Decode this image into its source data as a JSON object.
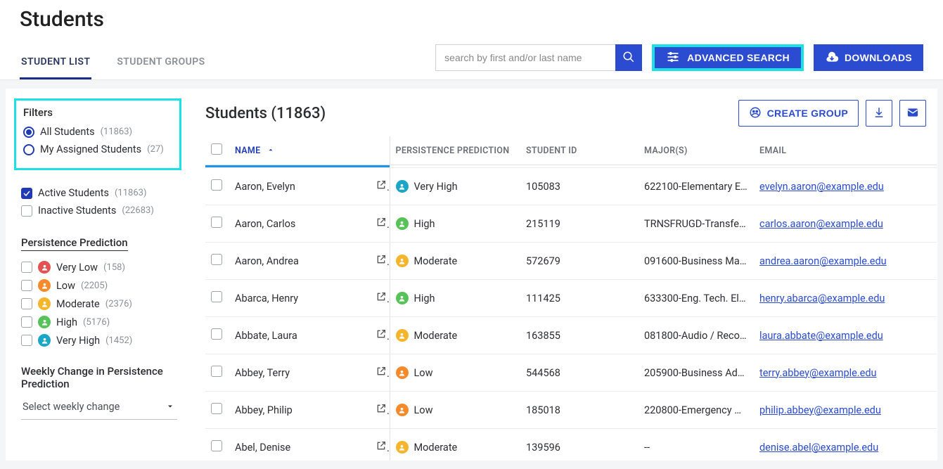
{
  "header": {
    "title": "Students",
    "tabs": [
      {
        "label": "STUDENT LIST",
        "active": true
      },
      {
        "label": "STUDENT GROUPS",
        "active": false
      }
    ],
    "search_placeholder": "search by first and/or last name",
    "advanced_search_label": "ADVANCED SEARCH",
    "downloads_label": "DOWNLOADS"
  },
  "sidebar": {
    "filters_title": "Filters",
    "scope": [
      {
        "label": "All Students",
        "count": "(11863)",
        "selected": true
      },
      {
        "label": "My Assigned Students",
        "count": "(27)",
        "selected": false
      }
    ],
    "status": [
      {
        "label": "Active Students",
        "count": "(11863)",
        "checked": true
      },
      {
        "label": "Inactive Students",
        "count": "(22683)",
        "checked": false
      }
    ],
    "persistence_title": "Persistence Prediction",
    "levels": [
      {
        "label": "Very Low",
        "count": "(158)",
        "class": "dot-vlow"
      },
      {
        "label": "Low",
        "count": "(2205)",
        "class": "dot-low"
      },
      {
        "label": "Moderate",
        "count": "(2376)",
        "class": "dot-mod"
      },
      {
        "label": "High",
        "count": "(5176)",
        "class": "dot-high"
      },
      {
        "label": "Very High",
        "count": "(1452)",
        "class": "dot-vhigh"
      }
    ],
    "weekly_title": "Weekly Change in Persistence Prediction",
    "weekly_placeholder": "Select weekly change"
  },
  "main": {
    "title": "Students (11863)",
    "create_group_label": "CREATE GROUP",
    "columns": {
      "name": "NAME",
      "prediction": "PERSISTENCE PREDICTION",
      "student_id": "STUDENT ID",
      "majors": "MAJOR(S)",
      "email": "EMAIL"
    },
    "rows": [
      {
        "name": "Aaron, Evelyn",
        "pred": "Very High",
        "pred_class": "dot-vhigh",
        "sid": "105083",
        "major": "622100-Elementary Ed…",
        "email": "evelyn.aaron@example.edu"
      },
      {
        "name": "Aaron, Carlos",
        "pred": "High",
        "pred_class": "dot-high",
        "sid": "215119",
        "major": "TRNSFRUGD-Transfer …",
        "email": "carlos.aaron@example.edu"
      },
      {
        "name": "Aaron, Andrea",
        "pred": "Moderate",
        "pred_class": "dot-mod",
        "sid": "572679",
        "major": "091600-Business Man…",
        "email": "andrea.aaron@example.edu"
      },
      {
        "name": "Abarca, Henry",
        "pred": "High",
        "pred_class": "dot-high",
        "sid": "111425",
        "major": "633300-Eng. Tech. Ele…",
        "email": "henry.abarca@example.edu"
      },
      {
        "name": "Abbate, Laura",
        "pred": "Moderate",
        "pred_class": "dot-mod",
        "sid": "163855",
        "major": "081800-Audio / Recor…",
        "email": "laura.abbate@example.edu"
      },
      {
        "name": "Abbey, Terry",
        "pred": "Low",
        "pred_class": "dot-low",
        "sid": "544568",
        "major": "205900-Business Adm…",
        "email": "terry.abbey@example.edu"
      },
      {
        "name": "Abbey, Philip",
        "pred": "Low",
        "pred_class": "dot-low",
        "sid": "185018",
        "major": "220800-Emergency M…",
        "email": "philip.abbey@example.edu"
      },
      {
        "name": "Abel, Denise",
        "pred": "Moderate",
        "pred_class": "dot-mod",
        "sid": "139596",
        "major": "--",
        "email": "denise.abel@example.edu"
      }
    ]
  }
}
